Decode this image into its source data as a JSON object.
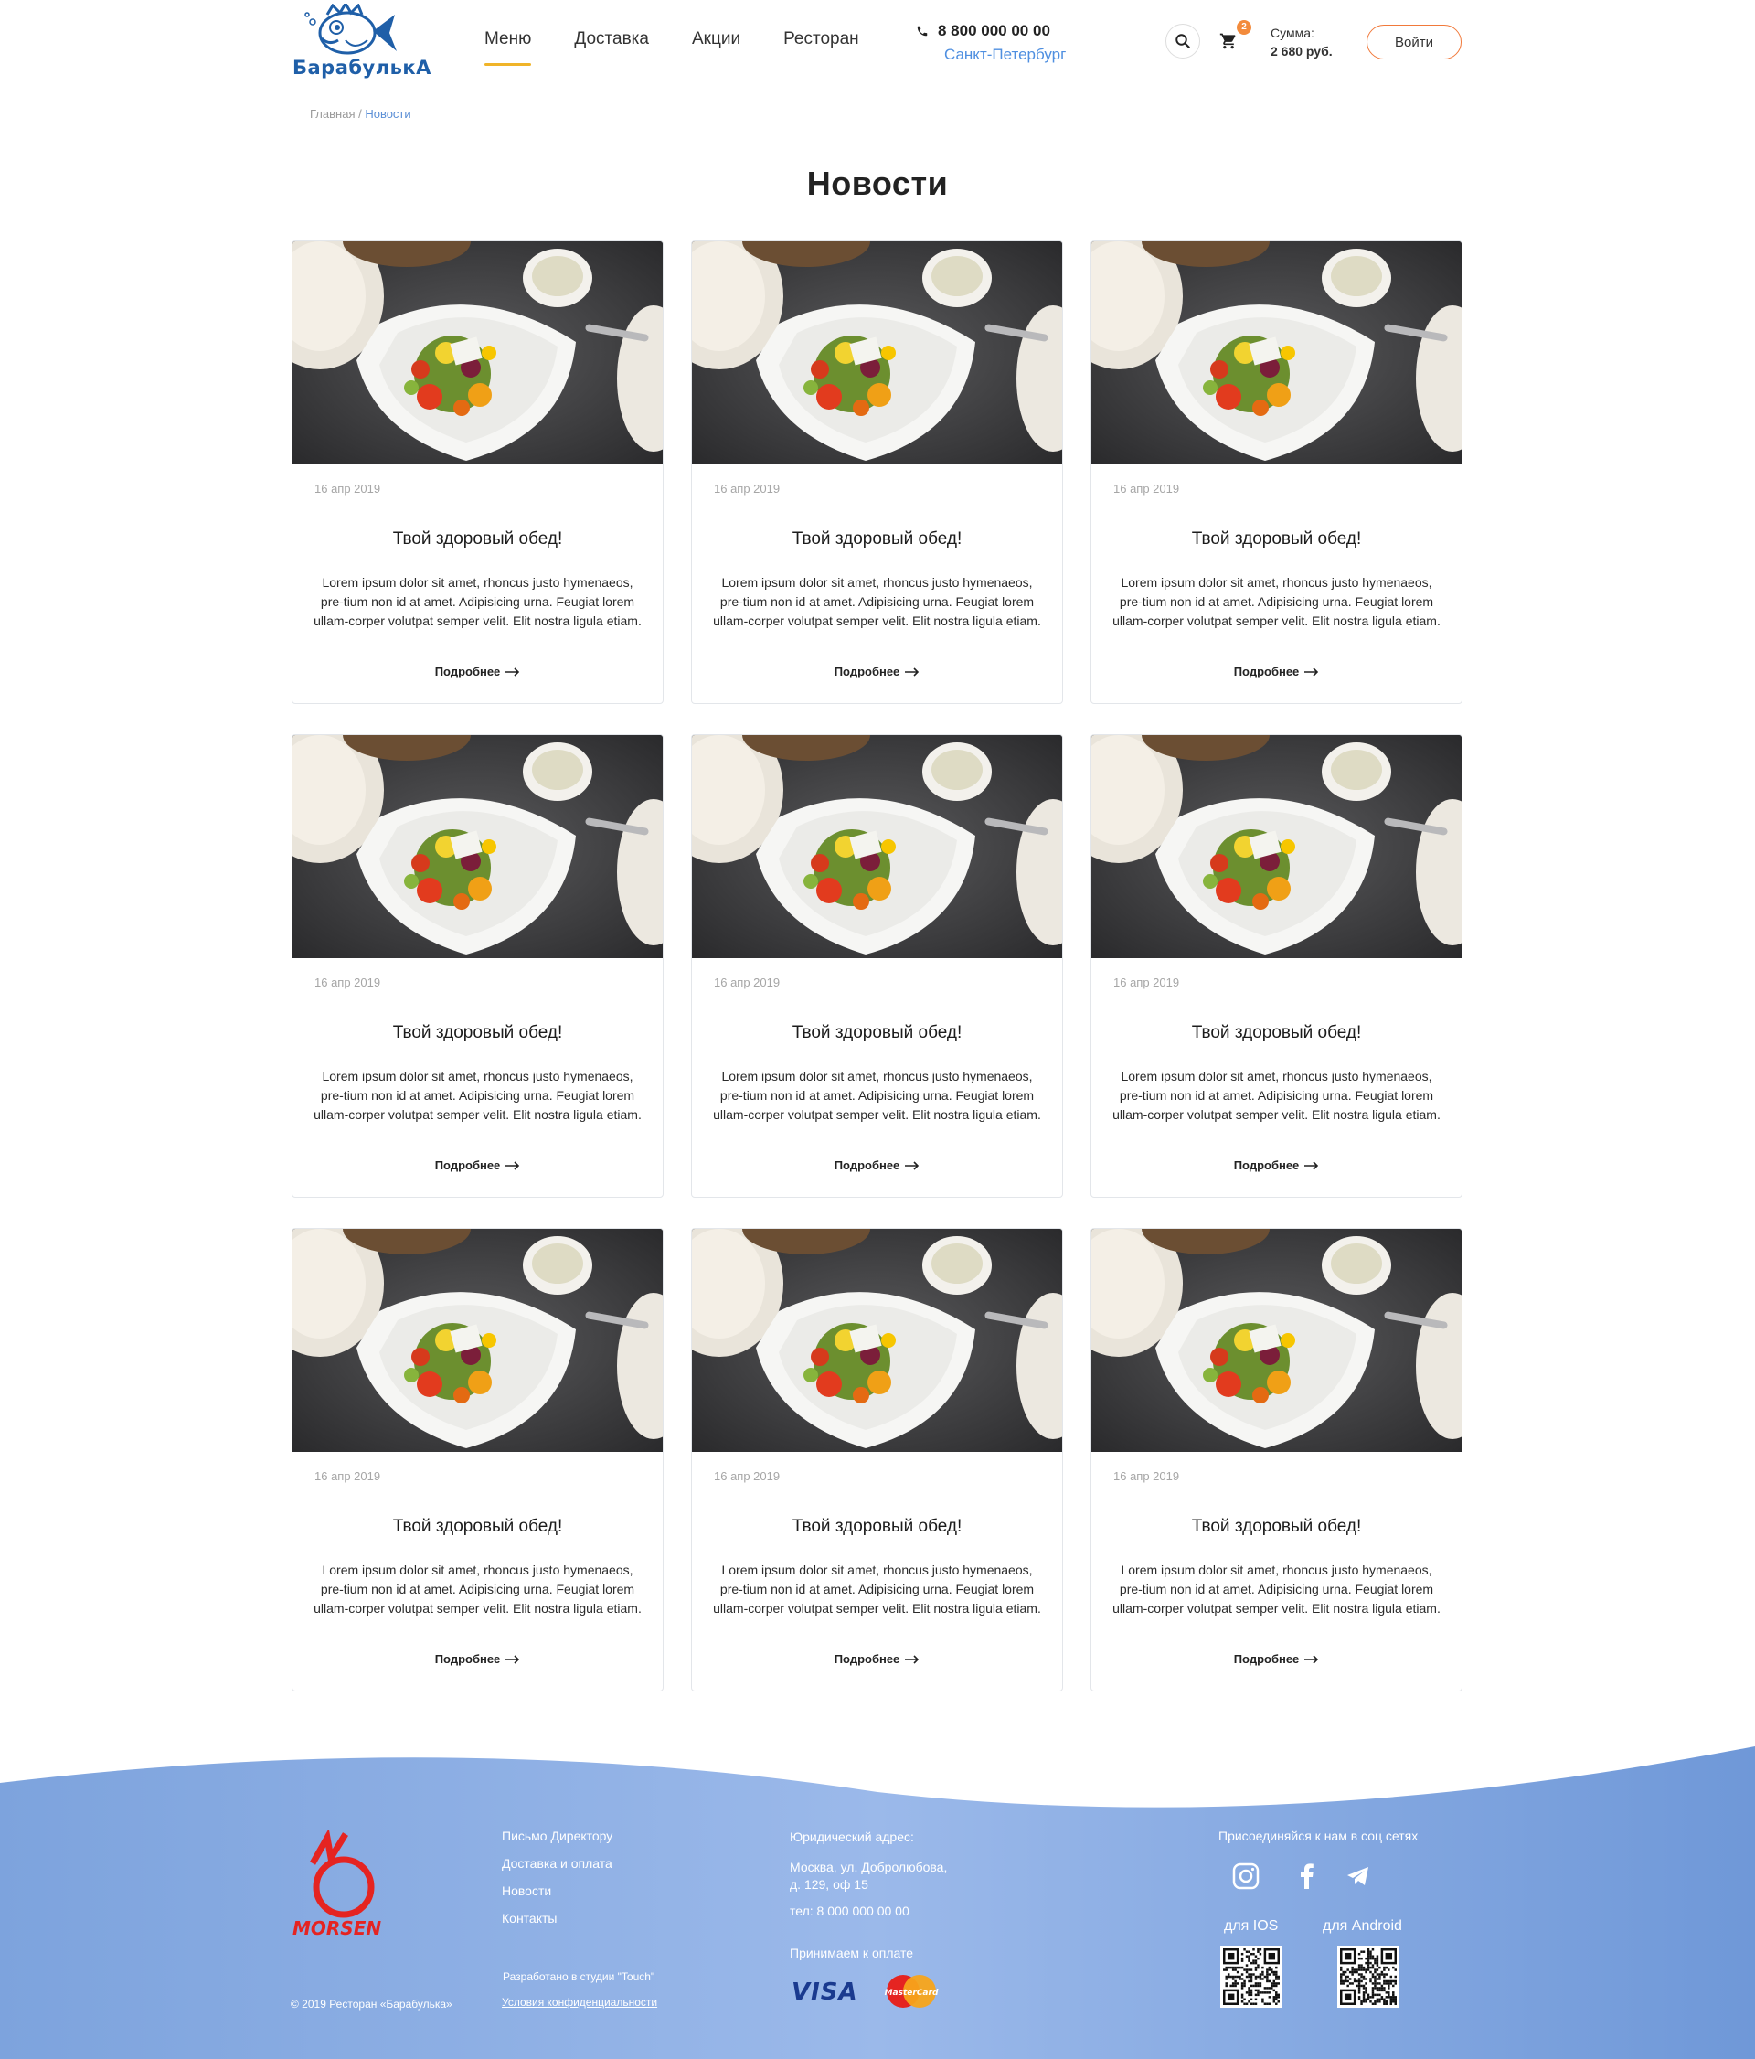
{
  "brand": {
    "logo_text": "БарабулькА"
  },
  "nav": [
    {
      "label": "Меню",
      "active": true
    },
    {
      "label": "Доставка",
      "active": false
    },
    {
      "label": "Акции",
      "active": false
    },
    {
      "label": "Ресторан",
      "active": false
    }
  ],
  "contact": {
    "phone": "8 800 000 00 00",
    "city": "Санкт-Петербург"
  },
  "cart": {
    "count": "2",
    "sum_label": "Сумма:",
    "sum_value": "2 680 руб."
  },
  "login_label": "Войти",
  "breadcrumb": {
    "home": "Главная",
    "separator": " / ",
    "current": "Новости"
  },
  "page_title": "Новости",
  "news": [
    {
      "date": "16 апр 2019",
      "title": "Твой здоровый обед!",
      "text": "Lorem ipsum dolor sit amet, rhoncus justo hymenaeos, pre-tium non id at amet. Adipisicing urna. Feugiat lorem ullam-corper volutpat semper velit. Elit nostra ligula etiam.",
      "more": "Подробнее"
    },
    {
      "date": "16 апр 2019",
      "title": "Твой здоровый обед!",
      "text": "Lorem ipsum dolor sit amet, rhoncus justo hymenaeos, pre-tium non id at amet. Adipisicing urna. Feugiat lorem ullam-corper volutpat semper velit. Elit nostra ligula etiam.",
      "more": "Подробнее"
    },
    {
      "date": "16 апр 2019",
      "title": "Твой здоровый обед!",
      "text": "Lorem ipsum dolor sit amet, rhoncus justo hymenaeos, pre-tium non id at amet. Adipisicing urna. Feugiat lorem ullam-corper volutpat semper velit. Elit nostra ligula etiam.",
      "more": "Подробнее"
    },
    {
      "date": "16 апр 2019",
      "title": "Твой здоровый обед!",
      "text": "Lorem ipsum dolor sit amet, rhoncus justo hymenaeos, pre-tium non id at amet. Adipisicing urna. Feugiat lorem ullam-corper volutpat semper velit. Elit nostra ligula etiam.",
      "more": "Подробнее"
    },
    {
      "date": "16 апр 2019",
      "title": "Твой здоровый обед!",
      "text": "Lorem ipsum dolor sit amet, rhoncus justo hymenaeos, pre-tium non id at amet. Adipisicing urna. Feugiat lorem ullam-corper volutpat semper velit. Elit nostra ligula etiam.",
      "more": "Подробнее"
    },
    {
      "date": "16 апр 2019",
      "title": "Твой здоровый обед!",
      "text": "Lorem ipsum dolor sit amet, rhoncus justo hymenaeos, pre-tium non id at amet. Adipisicing urna. Feugiat lorem ullam-corper volutpat semper velit. Elit nostra ligula etiam.",
      "more": "Подробнее"
    },
    {
      "date": "16 апр 2019",
      "title": "Твой здоровый обед!",
      "text": "Lorem ipsum dolor sit amet, rhoncus justo hymenaeos, pre-tium non id at amet. Adipisicing urna. Feugiat lorem ullam-corper volutpat semper velit. Elit nostra ligula etiam.",
      "more": "Подробнее"
    },
    {
      "date": "16 апр 2019",
      "title": "Твой здоровый обед!",
      "text": "Lorem ipsum dolor sit amet, rhoncus justo hymenaeos, pre-tium non id at amet. Adipisicing urna. Feugiat lorem ullam-corper volutpat semper velit. Elit nostra ligula etiam.",
      "more": "Подробнее"
    },
    {
      "date": "16 апр 2019",
      "title": "Твой здоровый обед!",
      "text": "Lorem ipsum dolor sit amet, rhoncus justo hymenaeos, pre-tium non id at amet. Adipisicing urna. Feugiat lorem ullam-corper volutpat semper velit. Elit nostra ligula etiam.",
      "more": "Подробнее"
    }
  ],
  "footer": {
    "links": [
      "Письмо Директору",
      "Доставка и оплата",
      "Новости",
      "Контакты"
    ],
    "copyright": "© 2019 Ресторан «Барабулька»",
    "developer": "Разработано в студии \"Touch\"",
    "privacy": "Условия конфиденциальности",
    "address_label": "Юридический адрес:",
    "address_line1": "Москва, ул. Добролюбова,",
    "address_line2": "д. 129, оф 15",
    "phone": "тел: 8 000 000 00 00",
    "payment_label": "Принимаем к оплате",
    "visa": "VISA",
    "mastercard": "MasterCard",
    "social_title": "Присоединяйся к нам в соц сетях",
    "ios_label": "для IOS",
    "android_label": "для Android",
    "morsen": "MORSEN"
  },
  "colors": {
    "accent_orange": "#f1793a",
    "nav_underline": "#f0b429",
    "link_blue": "#4f8fe0",
    "footer_blue": "#8fb2e6",
    "morsen_red": "#e52421"
  },
  "icons": [
    "phone-icon",
    "search-icon",
    "cart-icon",
    "arrow-right-icon",
    "instagram-icon",
    "facebook-icon",
    "telegram-icon",
    "qr-code-icon"
  ]
}
